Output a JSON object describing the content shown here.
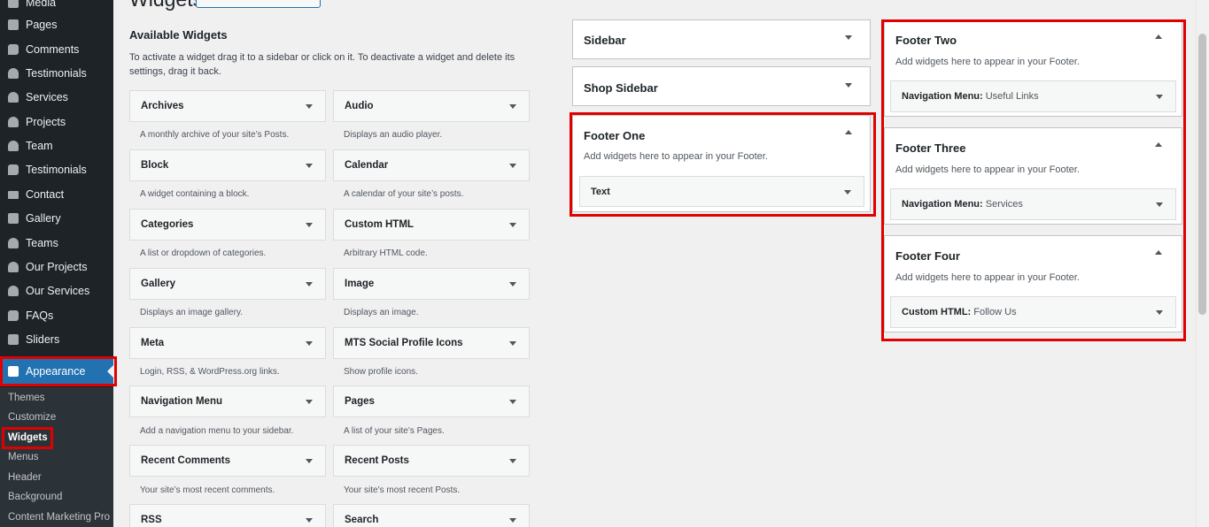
{
  "admin_menu": {
    "items": [
      {
        "label": "Media",
        "icon": "media-icon"
      },
      {
        "label": "Pages",
        "icon": "pages-icon"
      },
      {
        "label": "Comments",
        "icon": "comments-icon"
      },
      {
        "label": "Testimonials",
        "icon": "people-icon"
      },
      {
        "label": "Services",
        "icon": "people-icon"
      },
      {
        "label": "Projects",
        "icon": "people-icon"
      },
      {
        "label": "Team",
        "icon": "people-icon"
      },
      {
        "label": "Testimonials",
        "icon": "testimonial-icon"
      },
      {
        "label": "Contact",
        "icon": "mail-icon"
      },
      {
        "label": "Gallery",
        "icon": "gallery-icon"
      },
      {
        "label": "Teams",
        "icon": "teams-icon"
      },
      {
        "label": "Our Projects",
        "icon": "people-icon"
      },
      {
        "label": "Our Services",
        "icon": "people-icon"
      },
      {
        "label": "FAQs",
        "icon": "faq-icon"
      },
      {
        "label": "Sliders",
        "icon": "sliders-icon"
      }
    ],
    "appearance": {
      "label": "Appearance",
      "icon": "paintbrush-icon"
    },
    "submenu": [
      "Themes",
      "Customize",
      "Widgets",
      "Menus",
      "Header",
      "Background",
      "Content Marketing Pro"
    ]
  },
  "page": {
    "title": "Widgets"
  },
  "available": {
    "title": "Available Widgets",
    "description": "To activate a widget drag it to a sidebar or click on it. To deactivate a widget and delete its settings, drag it back.",
    "widgets": [
      {
        "title": "Archives",
        "desc": "A monthly archive of your site’s Posts."
      },
      {
        "title": "Audio",
        "desc": "Displays an audio player."
      },
      {
        "title": "Block",
        "desc": "A widget containing a block."
      },
      {
        "title": "Calendar",
        "desc": "A calendar of your site’s posts."
      },
      {
        "title": "Categories",
        "desc": "A list or dropdown of categories."
      },
      {
        "title": "Custom HTML",
        "desc": "Arbitrary HTML code."
      },
      {
        "title": "Gallery",
        "desc": "Displays an image gallery."
      },
      {
        "title": "Image",
        "desc": "Displays an image."
      },
      {
        "title": "Meta",
        "desc": "Login, RSS, & WordPress.org links."
      },
      {
        "title": "MTS Social Profile Icons",
        "desc": "Show profile icons."
      },
      {
        "title": "Navigation Menu",
        "desc": "Add a navigation menu to your sidebar."
      },
      {
        "title": "Pages",
        "desc": "A list of your site’s Pages."
      },
      {
        "title": "Recent Comments",
        "desc": "Your site’s most recent comments."
      },
      {
        "title": "Recent Posts",
        "desc": "Your site’s most recent Posts."
      },
      {
        "title": "RSS",
        "desc": ""
      },
      {
        "title": "Search",
        "desc": ""
      }
    ]
  },
  "sidebars": {
    "sidebar": {
      "title": "Sidebar"
    },
    "shop_sidebar": {
      "title": "Shop Sidebar"
    },
    "footer_one": {
      "title": "Footer One",
      "desc": "Add widgets here to appear in your Footer.",
      "widget": {
        "name": "Text",
        "subtitle": ""
      }
    },
    "footer_two": {
      "title": "Footer Two",
      "desc": "Add widgets here to appear in your Footer.",
      "widget": {
        "name": "Navigation Menu:",
        "subtitle": "Useful Links"
      }
    },
    "footer_three": {
      "title": "Footer Three",
      "desc": "Add widgets here to appear in your Footer.",
      "widget": {
        "name": "Navigation Menu:",
        "subtitle": "Services"
      }
    },
    "footer_four": {
      "title": "Footer Four",
      "desc": "Add widgets here to appear in your Footer.",
      "widget": {
        "name": "Custom HTML:",
        "subtitle": "Follow Us"
      }
    }
  },
  "colors": {
    "highlight": "#e00000",
    "menu_bg": "#1d2327",
    "accent": "#2271b1"
  }
}
